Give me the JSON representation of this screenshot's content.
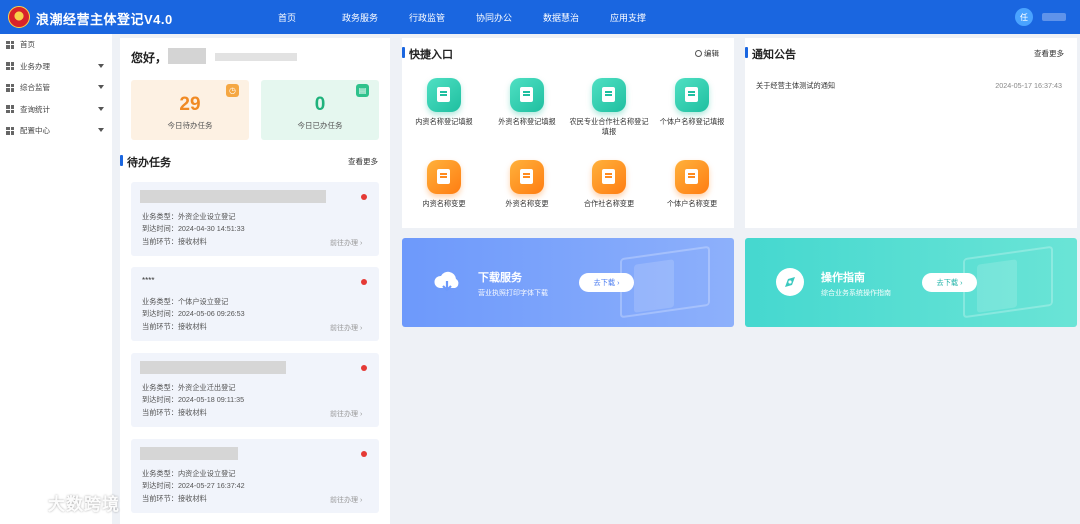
{
  "app": {
    "title": "浪潮经营主体登记V4.0",
    "user_avatar_text": "任"
  },
  "topnav": [
    "首页",
    "政务服务",
    "行政监管",
    "协同办公",
    "数据慧治",
    "应用支撑"
  ],
  "sidebar": {
    "items": [
      {
        "label": "首页",
        "caret": false
      },
      {
        "label": "业务办理",
        "caret": true
      },
      {
        "label": "综合监管",
        "caret": true
      },
      {
        "label": "查询统计",
        "caret": true
      },
      {
        "label": "配置中心",
        "caret": true
      }
    ]
  },
  "greeting": "您好，",
  "stats": {
    "todo": {
      "value": "29",
      "label": "今日待办任务"
    },
    "done": {
      "value": "0",
      "label": "今日已办任务"
    }
  },
  "tasks": {
    "title": "待办任务",
    "more": "查看更多",
    "items": [
      {
        "masked": "",
        "type": "业务类型：外资企业设立登记",
        "time": "到达时间：2024-04-30 14:51:33",
        "step": "当前环节：接收材料",
        "link": "前往办理 ›"
      },
      {
        "masked": "****",
        "type": "业务类型：个体户设立登记",
        "time": "到达时间：2024-05-06 09:26:53",
        "step": "当前环节：接收材料",
        "link": "前往办理 ›"
      },
      {
        "masked": "",
        "type": "业务类型：外资企业迁出登记",
        "time": "到达时间：2024-05-18 09:11:35",
        "step": "当前环节：接收材料",
        "link": "前往办理 ›"
      },
      {
        "masked": "",
        "type": "业务类型：内资企业设立登记",
        "time": "到达时间：2024-05-27 16:37:42",
        "step": "当前环节：接收材料",
        "link": "前往办理 ›"
      }
    ]
  },
  "quick": {
    "title": "快捷入口",
    "edit": "编辑",
    "items": [
      {
        "label": "内资名称登记填报",
        "color": "teal"
      },
      {
        "label": "外资名称登记填报",
        "color": "teal"
      },
      {
        "label": "农民专业合作社名称登记填报",
        "color": "teal"
      },
      {
        "label": "个体户名称登记填报",
        "color": "teal"
      },
      {
        "label": "内资名称变更",
        "color": "orange"
      },
      {
        "label": "外资名称变更",
        "color": "orange"
      },
      {
        "label": "合作社名称变更",
        "color": "orange"
      },
      {
        "label": "个体户名称变更",
        "color": "orange"
      }
    ]
  },
  "notice": {
    "title": "通知公告",
    "more": "查看更多",
    "items": [
      {
        "text": "关于经营主体测试的通知",
        "date": "2024-05-17 16:37:43"
      }
    ]
  },
  "banners": {
    "download": {
      "title": "下载服务",
      "subtitle": "营业执照打印字体下载",
      "button": "去下载 ›"
    },
    "guide": {
      "title": "操作指南",
      "subtitle": "综合业务系统操作指南",
      "button": "去下载 ›"
    }
  },
  "watermark": "大数跨境",
  "colors": {
    "primary": "#1a66e0",
    "todo": "#f08a24",
    "done": "#1fb27c",
    "dot": "#e53935"
  }
}
